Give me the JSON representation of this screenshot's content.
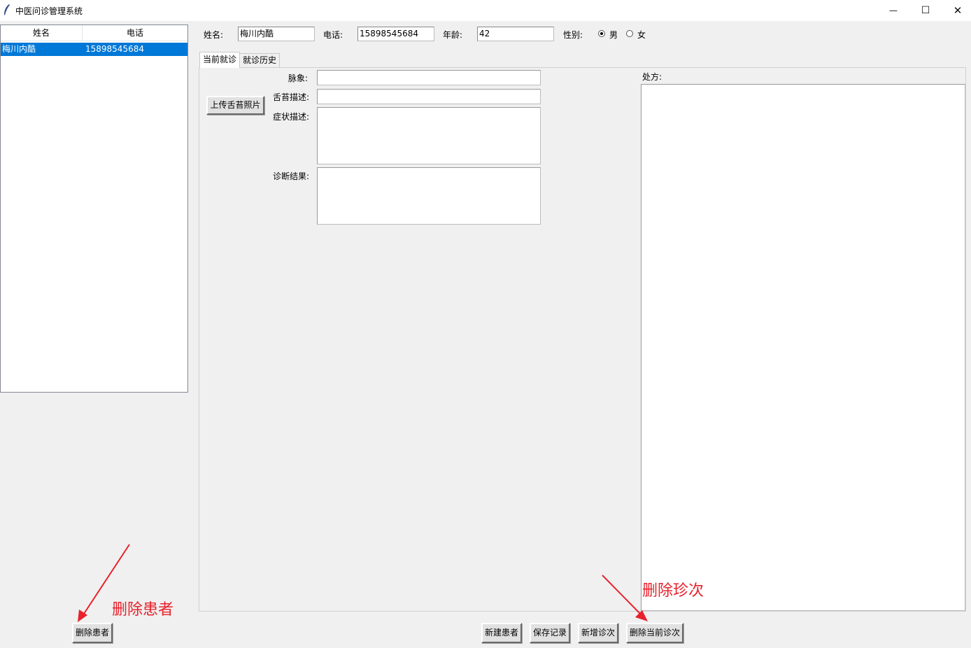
{
  "window": {
    "title": "中医问诊管理系统",
    "minimize_glyph": "—",
    "maximize_glyph": "☐",
    "close_glyph": "✕"
  },
  "patient_list": {
    "columns": [
      "姓名",
      "电话"
    ],
    "rows": [
      {
        "name": "梅川内酷",
        "phone": "15898545684",
        "selected": true
      }
    ]
  },
  "patient_form": {
    "name_label": "姓名:",
    "name_value": "梅川内酷",
    "phone_label": "电话:",
    "phone_value": "15898545684",
    "age_label": "年龄:",
    "age_value": "42",
    "gender_label": "性别:",
    "gender_options": [
      "男",
      "女"
    ],
    "gender_selected": "男"
  },
  "tabs": [
    {
      "label": "当前就诊",
      "active": true
    },
    {
      "label": "就诊历史",
      "active": false
    }
  ],
  "visit": {
    "upload_button": "上传舌苔照片",
    "pulse_label": "脉象:",
    "tongue_label": "舌苔描述:",
    "symptom_label": "症状描述:",
    "diagnosis_label": "诊断结果:",
    "prescription_label": "处方:"
  },
  "buttons": {
    "delete_patient": "删除患者",
    "new_patient": "新建患者",
    "save_record": "保存记录",
    "add_visit": "新增诊次",
    "delete_visit": "删除当前诊次"
  },
  "annotations": {
    "delete_patient_note": "删除患者",
    "delete_visit_note": "删除珍次",
    "color": "#e8212b"
  }
}
